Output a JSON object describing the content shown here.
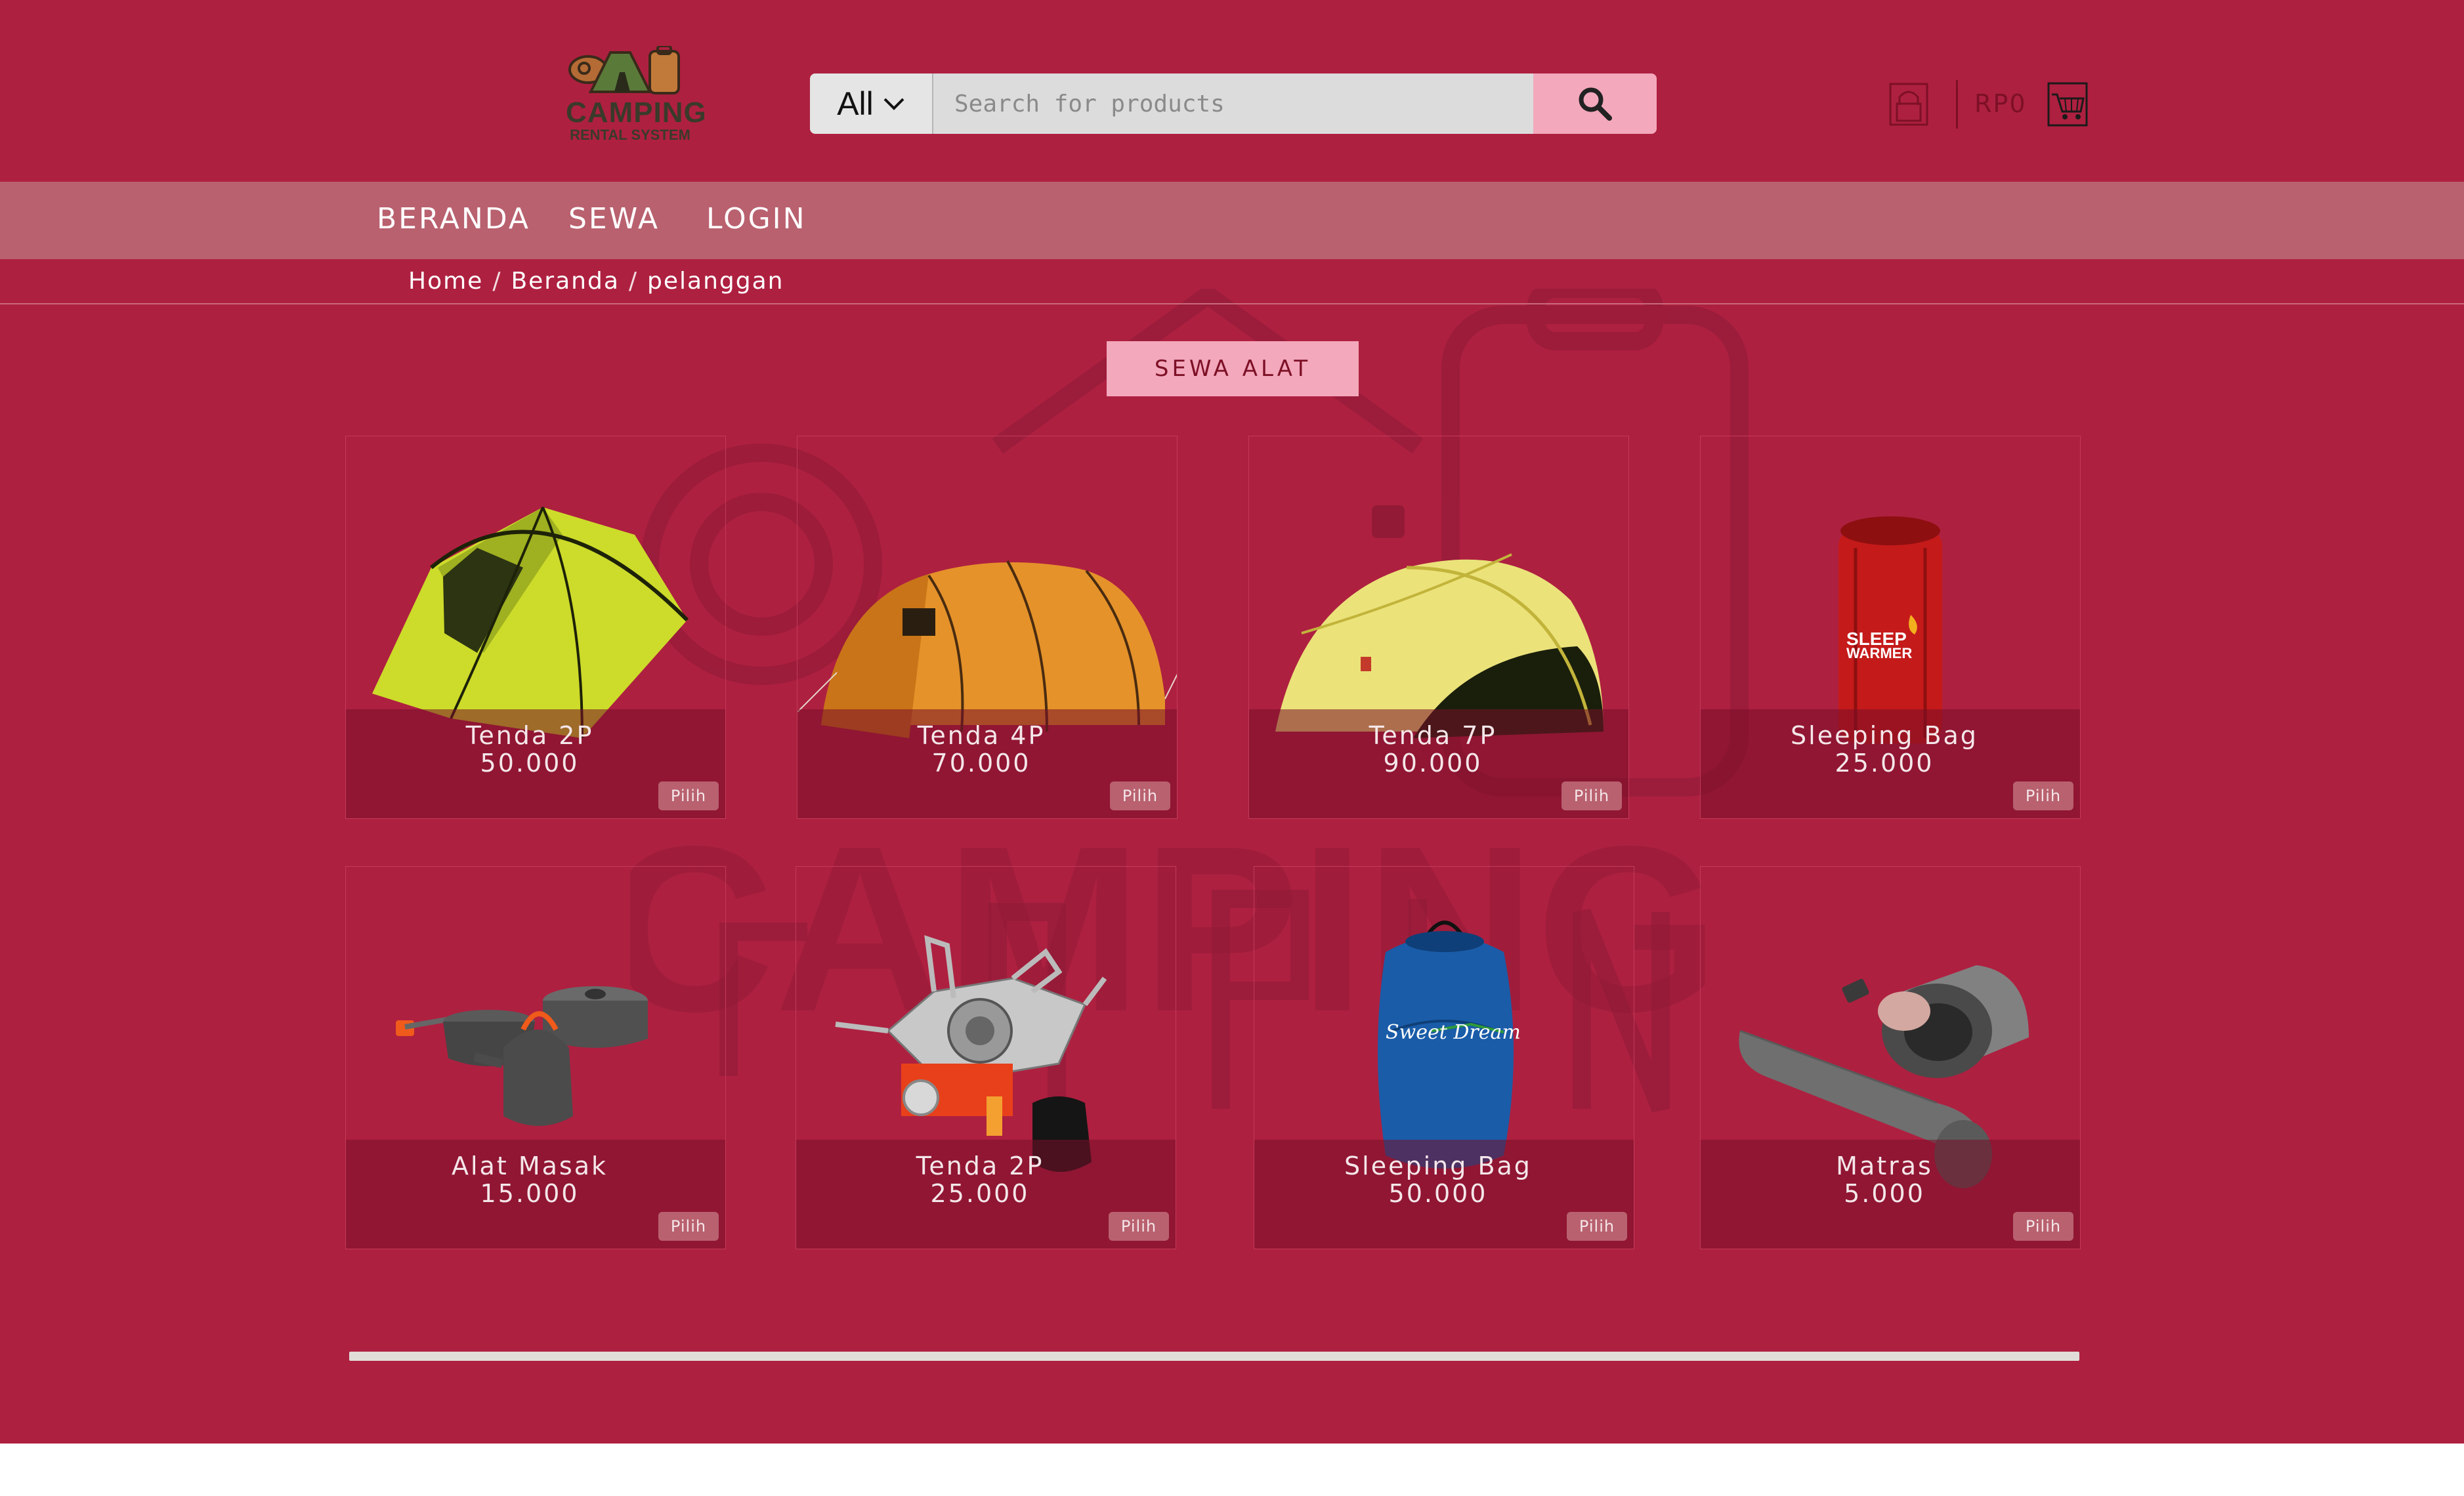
{
  "header": {
    "logo": {
      "title": "CAMPING",
      "subtitle": "RENTAL SYSTEM"
    },
    "search": {
      "category": "All",
      "placeholder": "Search for products"
    },
    "cart_total": "RP0"
  },
  "nav": {
    "items": [
      "BERANDA",
      "SEWA",
      "LOGIN"
    ]
  },
  "breadcrumb": [
    "Home",
    "Beranda",
    "pelanggan"
  ],
  "section": {
    "button_label": "SEWA ALAT"
  },
  "products": [
    {
      "name": "Tenda 2P",
      "price": "50.000",
      "button": "Pilih",
      "image": "tent-2p"
    },
    {
      "name": "Tenda 4P",
      "price": "70.000",
      "button": "Pilih",
      "image": "tent-4p"
    },
    {
      "name": "Tenda 7P",
      "price": "90.000",
      "button": "Pilih",
      "image": "tent-7p"
    },
    {
      "name": "Sleeping Bag",
      "price": "25.000",
      "button": "Pilih",
      "image": "sleeping-bag-red",
      "image_text": "SLEEP WARMER"
    },
    {
      "name": "Alat Masak",
      "price": "15.000",
      "button": "Pilih",
      "image": "cooking-set"
    },
    {
      "name": "Tenda 2P",
      "price": "25.000",
      "button": "Pilih",
      "image": "portable-stove"
    },
    {
      "name": "Sleeping Bag",
      "price": "50.000",
      "button": "Pilih",
      "image": "sleeping-bag-blue",
      "image_text": "Sweet Dream"
    },
    {
      "name": "Matras",
      "price": "5.000",
      "button": "Pilih",
      "image": "foam-mat"
    }
  ],
  "colors": {
    "page_bg": "#ae2040",
    "navbar_bg": "#b9616f",
    "accent_pink": "#f3a8bc",
    "dark_red": "#7d1026"
  }
}
